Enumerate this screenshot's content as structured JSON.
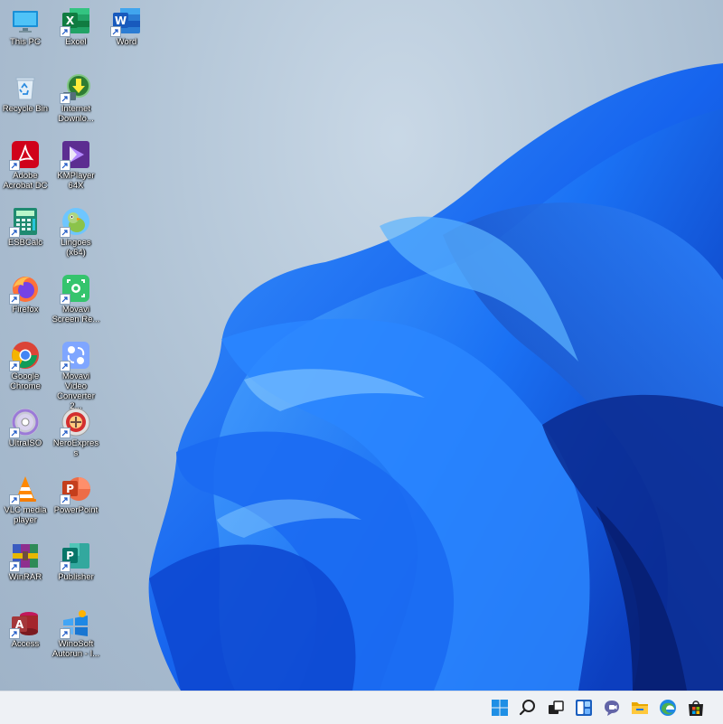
{
  "desktop": {
    "icons": [
      {
        "label": "This PC",
        "icon": "computer-icon"
      },
      {
        "label": "Excel",
        "icon": "excel-icon"
      },
      {
        "label": "Word",
        "icon": "word-icon"
      },
      {
        "label": "Recycle Bin",
        "icon": "recycle-bin-icon"
      },
      {
        "label": "Internet Downlo...",
        "icon": "idm-icon"
      },
      {
        "label": "Adobe Acrobat DC",
        "icon": "acrobat-icon"
      },
      {
        "label": "KMPlayer 64X",
        "icon": "kmplayer-icon"
      },
      {
        "label": "ESBCalc",
        "icon": "calculator-icon"
      },
      {
        "label": "Lingoes (x64)",
        "icon": "lingoes-icon"
      },
      {
        "label": "Firefox",
        "icon": "firefox-icon"
      },
      {
        "label": "Movavi Screen Re...",
        "icon": "movavi-screen-icon"
      },
      {
        "label": "Google Chrome",
        "icon": "chrome-icon"
      },
      {
        "label": "Movavi Video Converter 2...",
        "icon": "movavi-converter-icon"
      },
      {
        "label": "UltraISO",
        "icon": "ultraiso-icon"
      },
      {
        "label": "NeroExpress",
        "icon": "nero-icon"
      },
      {
        "label": "VLC media player",
        "icon": "vlc-icon"
      },
      {
        "label": "PowerPoint",
        "icon": "powerpoint-icon"
      },
      {
        "label": "WinRAR",
        "icon": "winrar-icon"
      },
      {
        "label": "Publisher",
        "icon": "publisher-icon"
      },
      {
        "label": "Access",
        "icon": "access-icon"
      },
      {
        "label": "WinoSoft Autorun - I...",
        "icon": "winosoft-icon"
      }
    ]
  },
  "taskbar": {
    "buttons": [
      {
        "icon": "windows-start-icon"
      },
      {
        "icon": "search-icon"
      },
      {
        "icon": "task-view-icon"
      },
      {
        "icon": "widgets-icon"
      },
      {
        "icon": "teams-chat-icon"
      },
      {
        "icon": "file-explorer-icon"
      },
      {
        "icon": "edge-icon"
      },
      {
        "icon": "microsoft-store-icon"
      }
    ]
  },
  "colors": {
    "accent": "#1a73e8",
    "wallpaper_bloom": "#1e64f0",
    "taskbar_bg": "#eef1f5"
  }
}
